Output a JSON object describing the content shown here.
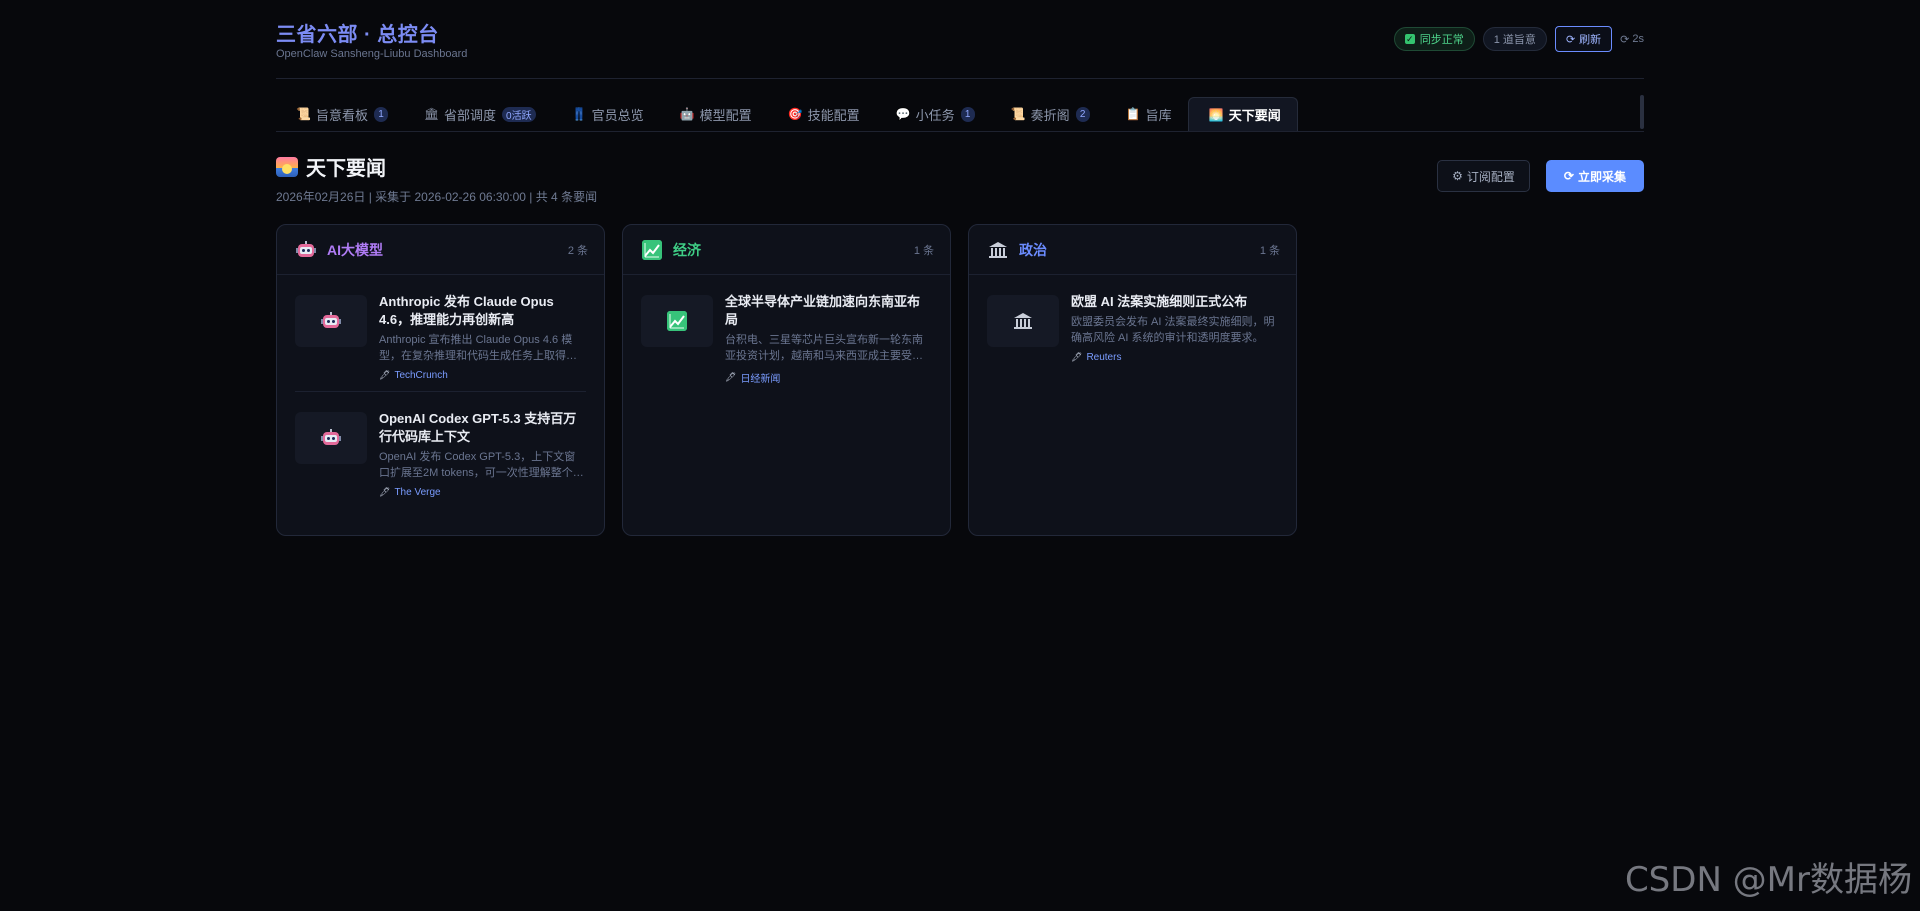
{
  "app": {
    "title": "三省六部 · 总控台",
    "subtitle": "OpenClaw Sansheng-Liubu Dashboard"
  },
  "header": {
    "sync_status": "同步正常",
    "decree_count": "1 道旨意",
    "refresh_label": "刷新",
    "refresh_interval": "2s",
    "accent_color": "#6b8cff",
    "sync_color": "#4ed38a"
  },
  "tabs": [
    {
      "icon": "scroll-icon",
      "glyph": "📜",
      "label": "旨意看板",
      "badge": "1",
      "active": false
    },
    {
      "icon": "classical-building-icon",
      "glyph": "🏛",
      "label": "省部调度",
      "badge": "0活跃",
      "active": false
    },
    {
      "icon": "jeans-icon",
      "glyph": "👖",
      "label": "官员总览",
      "badge": "",
      "active": false
    },
    {
      "icon": "robot-icon",
      "glyph": "🤖",
      "label": "模型配置",
      "badge": "",
      "active": false
    },
    {
      "icon": "target-icon",
      "glyph": "🎯",
      "label": "技能配置",
      "badge": "",
      "active": false
    },
    {
      "icon": "speech-bubble-icon",
      "glyph": "💬",
      "label": "小任务",
      "badge": "1",
      "active": false
    },
    {
      "icon": "scroll-icon",
      "glyph": "📜",
      "label": "奏折阁",
      "badge": "2",
      "active": false
    },
    {
      "icon": "memo-icon",
      "glyph": "📋",
      "label": "旨库",
      "badge": "",
      "active": false
    },
    {
      "icon": "sunrise-icon",
      "glyph": "🌅",
      "label": "天下要闻",
      "badge": "",
      "active": true
    }
  ],
  "section": {
    "title": "天下要闻",
    "meta": "2026年02月26日 | 采集于 2026-02-26 06:30:00 | 共 4 条要闻",
    "subscribe_label": "订阅配置",
    "collect_label": "立即采集"
  },
  "categories": [
    {
      "icon": "robot-icon",
      "title": "AI大模型",
      "title_color": "#b07cf5",
      "count": "2 条",
      "items": [
        {
          "thumb_icon": "robot-icon",
          "title": "Anthropic 发布 Claude Opus 4.6，推理能力再创新高",
          "summary": "Anthropic 宣布推出 Claude Opus 4.6 模型，在复杂推理和代码生成任务上取得…",
          "source": "TechCrunch"
        },
        {
          "thumb_icon": "robot-icon",
          "title": "OpenAI Codex GPT-5.3 支持百万行代码库上下文",
          "summary": "OpenAI 发布 Codex GPT-5.3，上下文窗口扩展至2M tokens，可一次性理解整个…",
          "source": "The Verge"
        }
      ]
    },
    {
      "icon": "chart-increasing-icon",
      "title": "经济",
      "title_color": "#3fcf86",
      "count": "1 条",
      "items": [
        {
          "thumb_icon": "chart-increasing-icon",
          "title": "全球半导体产业链加速向东南亚布局",
          "summary": "台积电、三星等芯片巨头宣布新一轮东南亚投资计划，越南和马来西亚成主要受…",
          "source": "日经新闻"
        }
      ]
    },
    {
      "icon": "classical-building-icon",
      "title": "政治",
      "title_color": "#6b8cff",
      "count": "1 条",
      "items": [
        {
          "thumb_icon": "classical-building-icon",
          "title": "欧盟 AI 法案实施细则正式公布",
          "summary": "欧盟委员会发布 AI 法案最终实施细则，明确高风险 AI 系统的审计和透明度要求。",
          "source": "Reuters"
        }
      ]
    }
  ],
  "watermark": "CSDN @Mr数据杨"
}
